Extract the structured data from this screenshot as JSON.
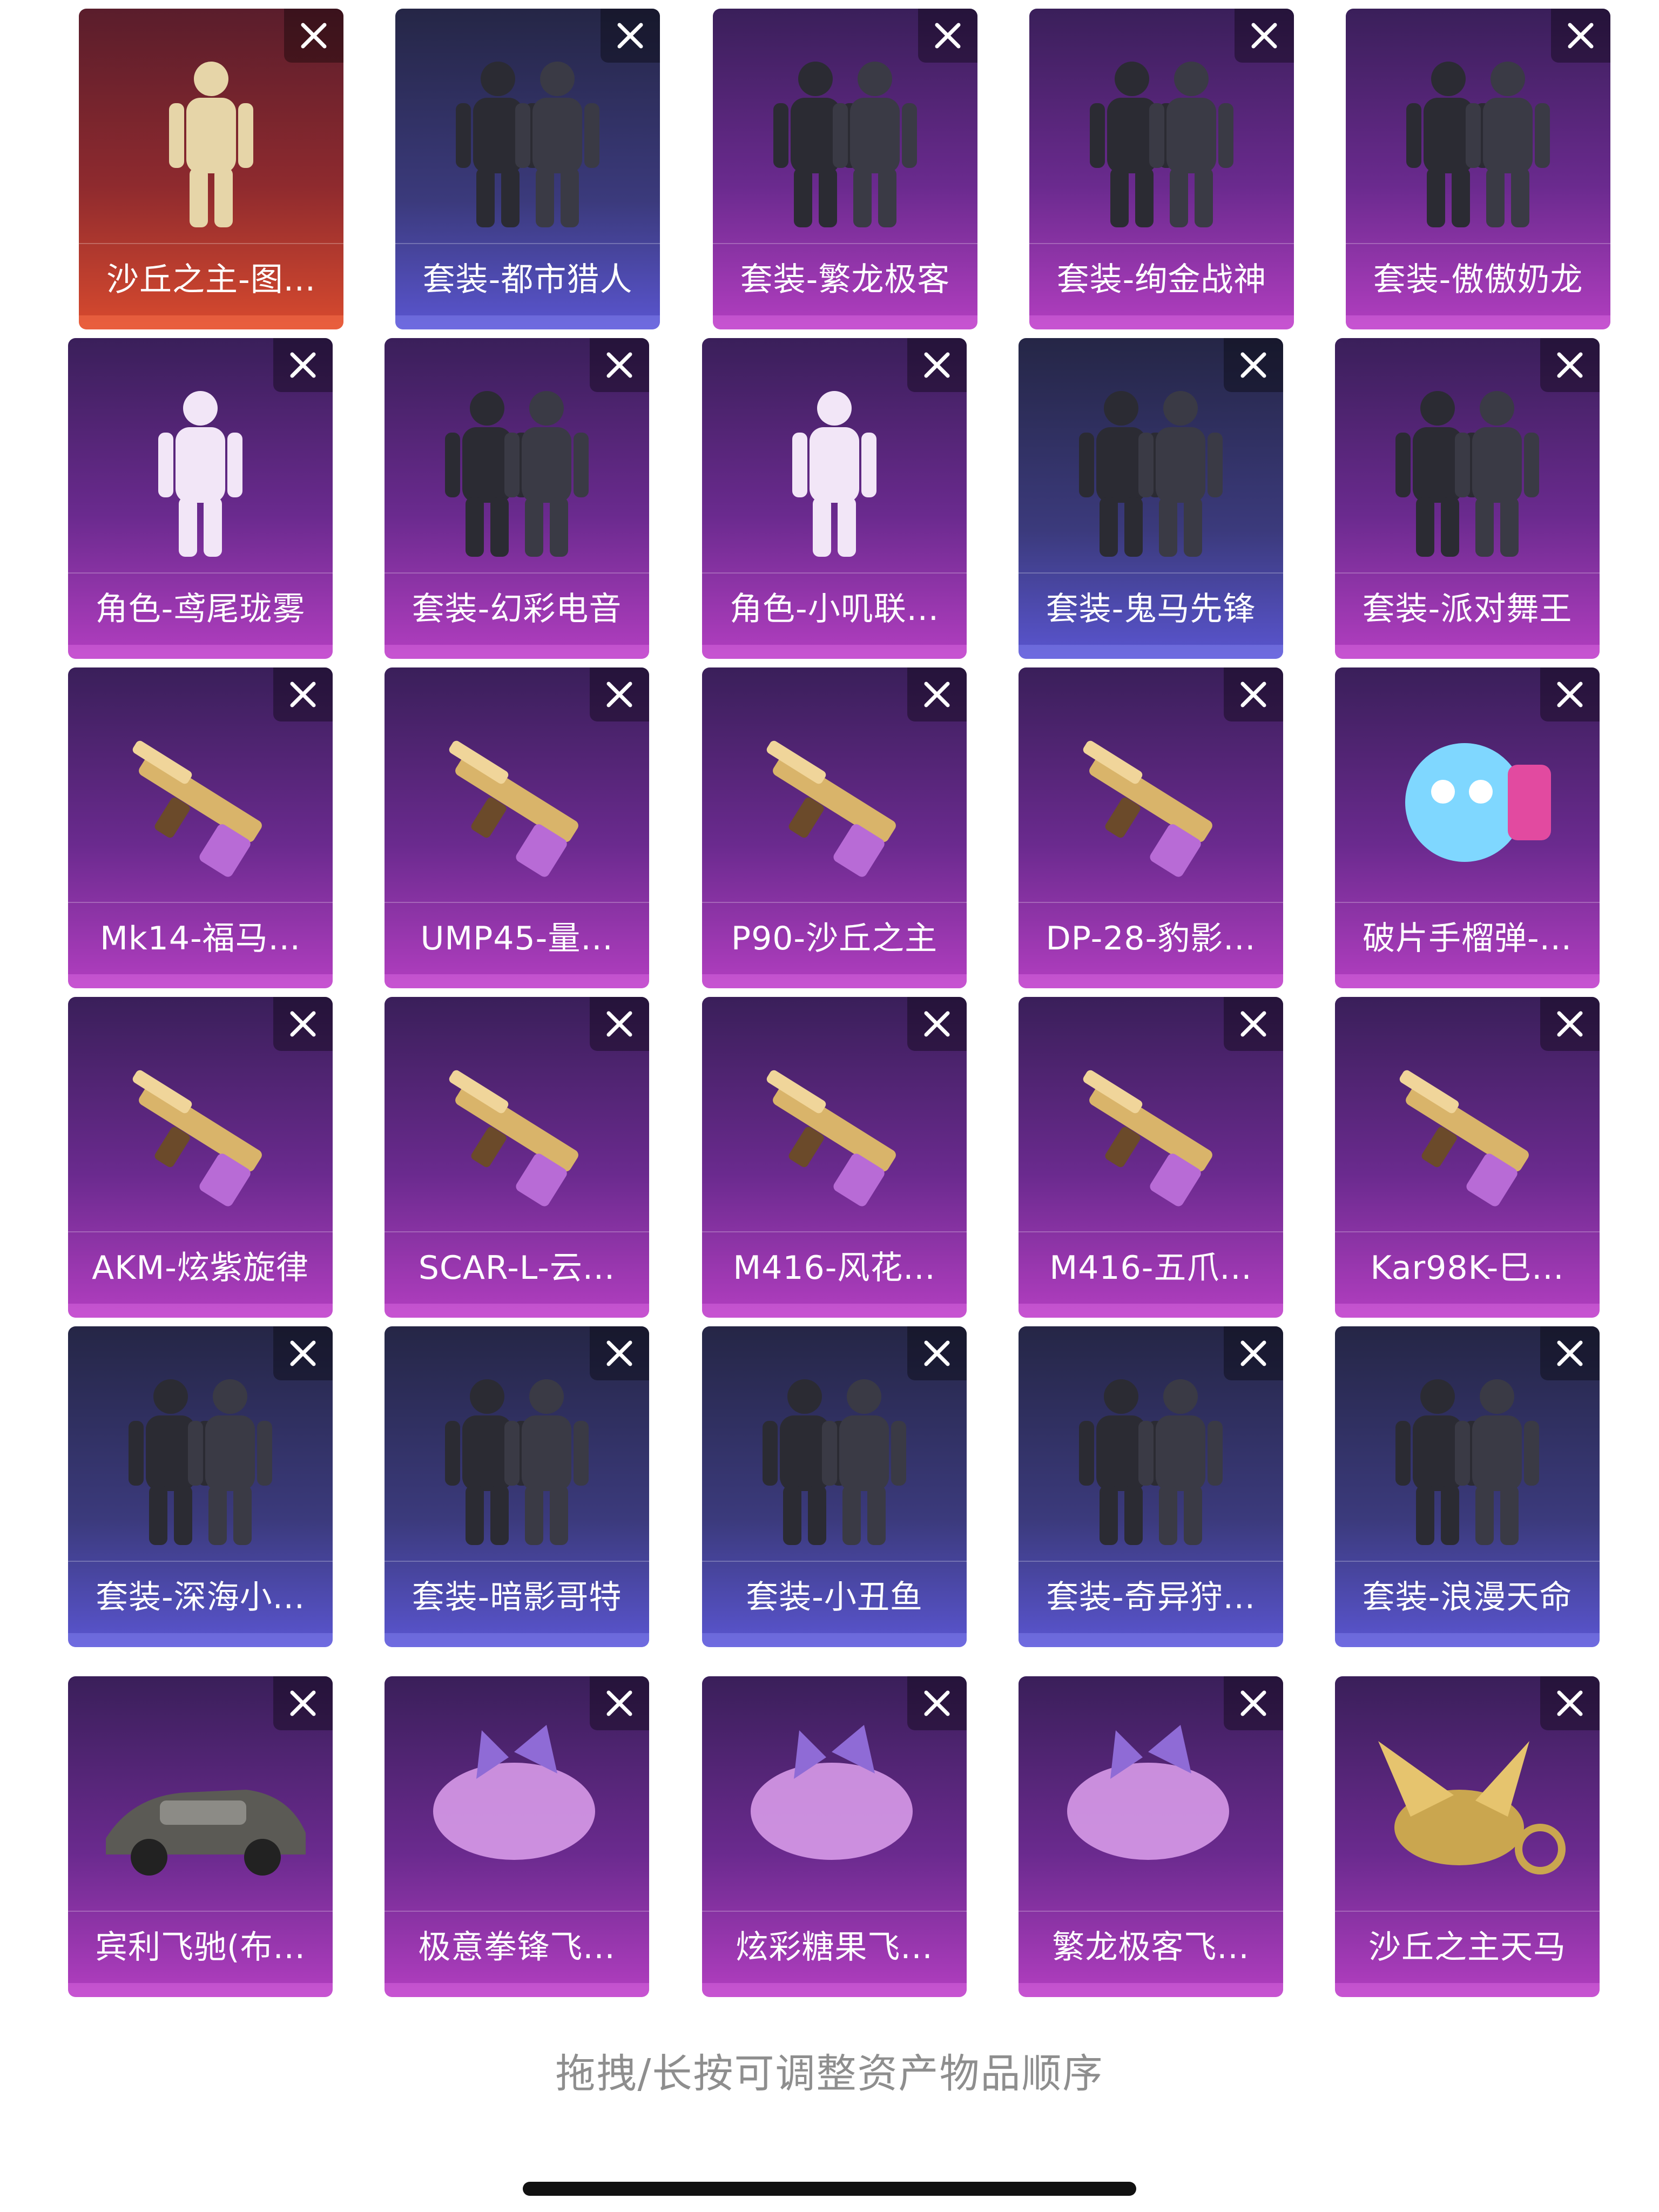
{
  "items": [
    {
      "label": "沙丘之主-图...",
      "theme": "red",
      "icon": "mummy-character-icon"
    },
    {
      "label": "套装-都市猎人",
      "theme": "blue",
      "icon": "outfit-icon"
    },
    {
      "label": "套装-繁龙极客",
      "theme": "purple",
      "icon": "outfit-icon"
    },
    {
      "label": "套装-绚金战神",
      "theme": "purple",
      "icon": "outfit-icon"
    },
    {
      "label": "套装-傲傲奶龙",
      "theme": "purple",
      "icon": "outfit-icon"
    },
    {
      "label": "角色-鸢尾珑雾",
      "theme": "purple",
      "icon": "character-icon"
    },
    {
      "label": "套装-幻彩电音",
      "theme": "purple",
      "icon": "outfit-icon"
    },
    {
      "label": "角色-小叽联...",
      "theme": "purple",
      "icon": "character-icon"
    },
    {
      "label": "套装-鬼马先锋",
      "theme": "blue",
      "icon": "outfit-icon"
    },
    {
      "label": "套装-派对舞王",
      "theme": "purple",
      "icon": "outfit-icon"
    },
    {
      "label": "Mk14-福马...",
      "theme": "purple",
      "icon": "rifle-icon"
    },
    {
      "label": "UMP45-量...",
      "theme": "purple",
      "icon": "smg-icon"
    },
    {
      "label": "P90-沙丘之主",
      "theme": "purple",
      "icon": "smg-icon"
    },
    {
      "label": "DP-28-豹影...",
      "theme": "purple",
      "icon": "lmg-icon"
    },
    {
      "label": "破片手榴弹-...",
      "theme": "purple",
      "icon": "grenade-icon"
    },
    {
      "label": "AKM-炫紫旋律",
      "theme": "purple",
      "icon": "rifle-icon"
    },
    {
      "label": "SCAR-L-云...",
      "theme": "purple",
      "icon": "rifle-icon"
    },
    {
      "label": "M416-风花...",
      "theme": "purple",
      "icon": "rifle-icon"
    },
    {
      "label": "M416-五爪...",
      "theme": "purple",
      "icon": "rifle-icon"
    },
    {
      "label": "Kar98K-巳...",
      "theme": "purple",
      "icon": "sniper-icon"
    },
    {
      "label": "套装-深海小...",
      "theme": "blue",
      "icon": "outfit-icon"
    },
    {
      "label": "套装-暗影哥特",
      "theme": "blue",
      "icon": "outfit-icon"
    },
    {
      "label": "套装-小丑鱼",
      "theme": "blue",
      "icon": "outfit-icon"
    },
    {
      "label": "套装-奇异狩...",
      "theme": "blue",
      "icon": "outfit-icon"
    },
    {
      "label": "套装-浪漫天命",
      "theme": "blue",
      "icon": "outfit-icon"
    },
    {
      "label": "宾利飞驰(布...",
      "theme": "purple",
      "icon": "car-icon"
    },
    {
      "label": "极意拳锋飞...",
      "theme": "purple",
      "icon": "glider-icon"
    },
    {
      "label": "炫彩糖果飞...",
      "theme": "purple",
      "icon": "glider-icon"
    },
    {
      "label": "繁龙极客飞...",
      "theme": "purple",
      "icon": "glider-icon"
    },
    {
      "label": "沙丘之主天马",
      "theme": "purple",
      "icon": "pegasus-icon"
    }
  ],
  "close_icon": "close-icon",
  "hint": "拖拽/长按可调整资产物品顺序"
}
